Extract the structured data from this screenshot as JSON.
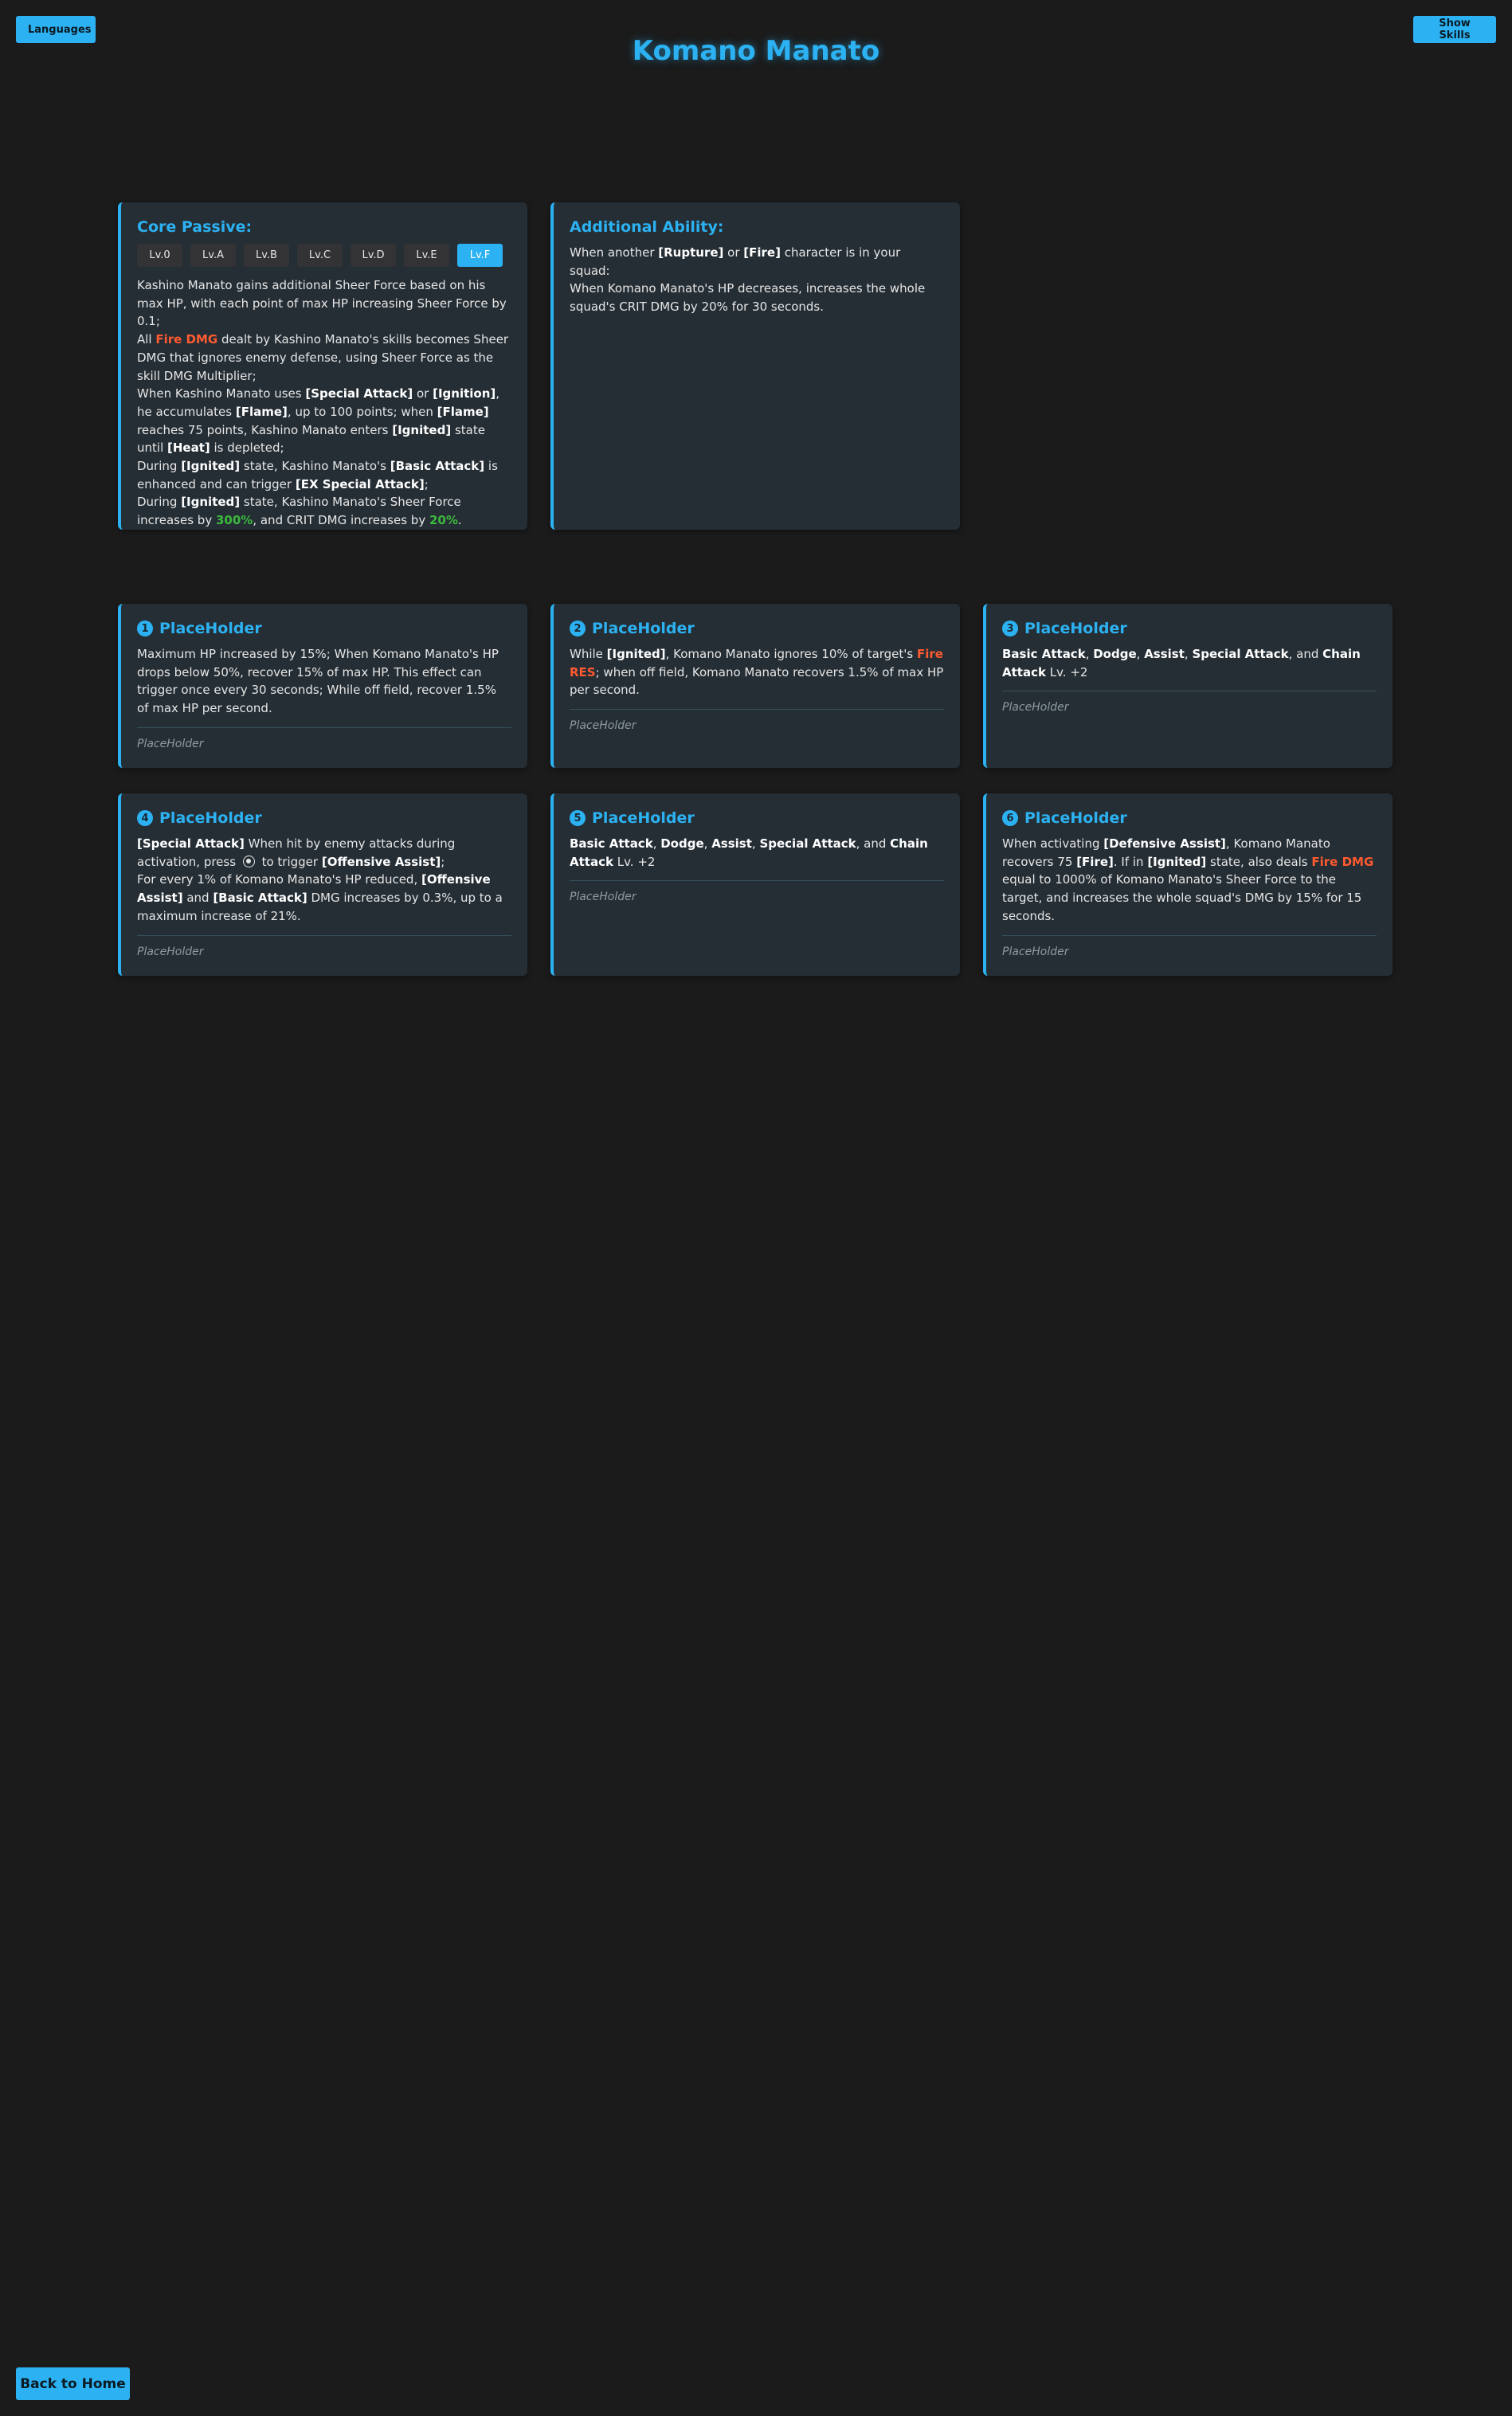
{
  "header": {
    "languages_label": "Languages",
    "show_skills_label": "Show Skills",
    "title": "Komano Manato"
  },
  "core_passive": {
    "title": "Core Passive:",
    "levels": [
      "Lv.0",
      "Lv.A",
      "Lv.B",
      "Lv.C",
      "Lv.D",
      "Lv.E",
      "Lv.F"
    ],
    "active_level": "Lv.F",
    "t1": "Kashino Manato gains additional Sheer Force based on his max HP, with each point of max HP increasing Sheer Force by 0.1;",
    "t2a": "All ",
    "t2b": "Fire DMG",
    "t2c": " dealt by Kashino Manato's skills becomes Sheer DMG that ignores enemy defense, using Sheer Force as the skill DMG Multiplier;",
    "t3a": "When Kashino Manato uses ",
    "t3b": "[Special Attack]",
    "t3c": " or ",
    "t3d": "[Ignition]",
    "t3e": ", he accumulates ",
    "t3f": "[Flame]",
    "t3g": ", up to 100 points; when ",
    "t3h": "[Flame]",
    "t3i": " reaches 75 points, Kashino Manato enters ",
    "t3j": "[Ignited]",
    "t3k": " state until ",
    "t3l": "[Heat]",
    "t3m": " is depleted;",
    "t4a": "During ",
    "t4b": "[Ignited]",
    "t4c": " state, Kashino Manato's ",
    "t4d": "[Basic Attack]",
    "t4e": " is enhanced and can trigger ",
    "t4f": "[EX Special Attack]",
    "t4g": ";",
    "t5a": "During ",
    "t5b": "[Ignited]",
    "t5c": " state, Kashino Manato's Sheer Force increases by ",
    "t5d": "300%",
    "t5e": ", and CRIT DMG increases by ",
    "t5f": "20%",
    "t5g": "."
  },
  "additional_ability": {
    "title": "Additional Ability:",
    "t1a": "When another ",
    "t1b": "[Rupture]",
    "t1c": " or ",
    "t1d": "[Fire]",
    "t1e": " character is in your squad:",
    "t2": "When Komano Manato's HP decreases, increases the whole squad's CRIT DMG by 20% for 30 seconds."
  },
  "cinemas": [
    {
      "num": "1",
      "title": "PlaceHolder",
      "text": "Maximum HP increased by 15%; When Komano Manato's HP drops below 50%, recover 15% of max HP. This effect can trigger once every 30 seconds; While off field, recover 1.5% of max HP per second.",
      "footer": "PlaceHolder"
    },
    {
      "num": "2",
      "title": "PlaceHolder",
      "t1": "While ",
      "t2": "[Ignited]",
      "t3": ", Komano Manato ignores 10% of target's ",
      "t4": "Fire RES",
      "t5": "; when off field, Komano Manato recovers 1.5% of max HP per second.",
      "footer": "PlaceHolder"
    },
    {
      "num": "3",
      "title": "PlaceHolder",
      "t1": "Basic Attack",
      "t2": ", ",
      "t3": "Dodge",
      "t4": ", ",
      "t5": "Assist",
      "t6": ", ",
      "t7": "Special Attack",
      "t8": ", and ",
      "t9": "Chain Attack",
      "t10": " Lv. +2",
      "footer": "PlaceHolder"
    },
    {
      "num": "4",
      "title": "PlaceHolder",
      "t1": "[Special Attack]",
      "t2": " When hit by enemy attacks during activation, press ",
      "t3": " to trigger ",
      "t4": "[Offensive Assist]",
      "t5": ";",
      "t6": "For every 1% of Komano Manato's HP reduced, ",
      "t7": "[Offensive Assist]",
      "t8": " and ",
      "t9": "[Basic Attack]",
      "t10": " DMG increases by 0.3%, up to a maximum increase of 21%.",
      "footer": "PlaceHolder"
    },
    {
      "num": "5",
      "title": "PlaceHolder",
      "t1": "Basic Attack",
      "t2": ", ",
      "t3": "Dodge",
      "t4": ", ",
      "t5": "Assist",
      "t6": ", ",
      "t7": "Special Attack",
      "t8": ", and ",
      "t9": "Chain Attack",
      "t10": " Lv. +2",
      "footer": "PlaceHolder"
    },
    {
      "num": "6",
      "title": "PlaceHolder",
      "t1": "When activating ",
      "t2": "[Defensive Assist]",
      "t3": ", Komano Manato recovers 75 ",
      "t4": "[Fire]",
      "t5": ". If in ",
      "t6": "[Ignited]",
      "t7": " state, also deals ",
      "t8": "Fire DMG",
      "t9": " equal to 1000% of Komano Manato's Sheer Force to the target, and increases the whole squad's DMG by 15% for 15 seconds.",
      "footer": "PlaceHolder"
    }
  ],
  "footer": {
    "back_label": "Back to Home"
  },
  "colors": {
    "accent": "#2cb2f2",
    "background": "#1b1b1b",
    "card": "#252e35",
    "fire": "#ff5a30",
    "buff": "#3cb83c"
  },
  "icons": {
    "assist_button_icon": "gamepad-button-icon"
  }
}
